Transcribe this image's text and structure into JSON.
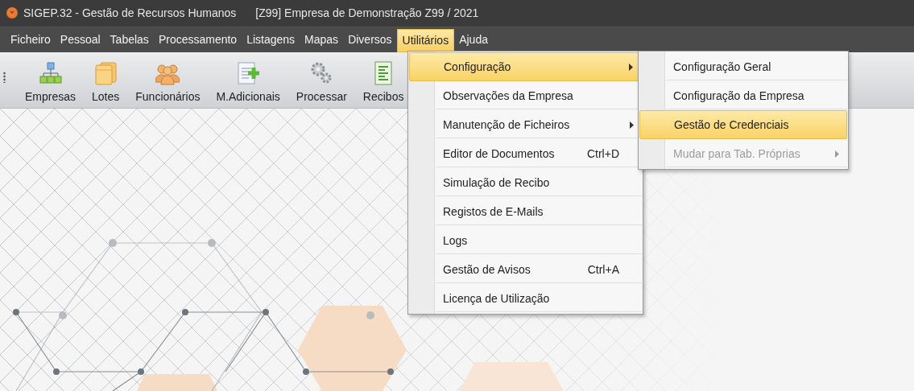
{
  "window": {
    "title": "SIGEP.32 - Gestão de Recursos Humanos",
    "company": "[Z99]  Empresa de Demonstração Z99 / 2021"
  },
  "menu_bar": [
    {
      "label": "Ficheiro",
      "selected": false
    },
    {
      "label": "Pessoal",
      "selected": false
    },
    {
      "label": "Tabelas",
      "selected": false
    },
    {
      "label": "Processamento",
      "selected": false
    },
    {
      "label": "Listagens",
      "selected": false
    },
    {
      "label": "Mapas",
      "selected": false
    },
    {
      "label": "Diversos",
      "selected": false
    },
    {
      "label": "Utilitários",
      "selected": true
    },
    {
      "label": "Ajuda",
      "selected": false
    }
  ],
  "toolbar": [
    {
      "label": "Empresas",
      "kind": "hierarchy"
    },
    {
      "label": "Lotes",
      "kind": "folders"
    },
    {
      "label": "Funcionários",
      "kind": "people"
    },
    {
      "label": "M.Adicionais",
      "kind": "document-add"
    },
    {
      "label": "Processar",
      "kind": "gears"
    },
    {
      "label": "Recibos",
      "kind": "receipt"
    }
  ],
  "dropdown": {
    "items": [
      {
        "label": "Configuração",
        "selected": true,
        "submenu": true
      },
      {
        "label": "Observações da Empresa",
        "selected": false,
        "submenu": false
      },
      {
        "label": "Manutenção de Ficheiros",
        "selected": false,
        "submenu": true
      },
      {
        "label": "Editor de Documentos",
        "shortcut": "Ctrl+D",
        "selected": false,
        "submenu": false
      },
      {
        "label": "Simulação de Recibo",
        "selected": false,
        "submenu": false
      },
      {
        "label": "Registos de E-Mails",
        "selected": false,
        "submenu": false
      },
      {
        "label": "Logs",
        "selected": false,
        "submenu": false
      },
      {
        "label": "Gestão de Avisos",
        "shortcut": "Ctrl+A",
        "selected": false,
        "submenu": false
      },
      {
        "label": "Licença de Utilização",
        "selected": false,
        "submenu": false
      }
    ]
  },
  "submenu": {
    "items": [
      {
        "label": "Configuração Geral",
        "selected": false,
        "disabled": false,
        "submenu": false
      },
      {
        "label": "Configuração da Empresa",
        "selected": false,
        "disabled": false,
        "submenu": false
      },
      {
        "label": "Gestão de Credenciais",
        "selected": true,
        "disabled": false,
        "submenu": false
      },
      {
        "label": "Mudar para Tab. Próprias",
        "selected": false,
        "disabled": true,
        "submenu": true
      }
    ]
  }
}
